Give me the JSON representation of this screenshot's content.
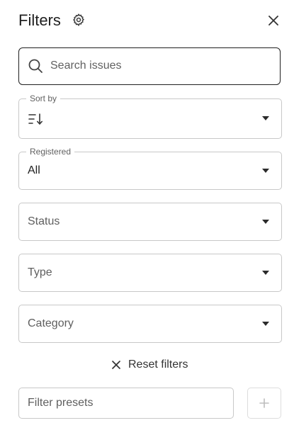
{
  "header": {
    "title": "Filters",
    "settings_icon": "gear-icon",
    "close_icon": "close-icon"
  },
  "search": {
    "placeholder": "Search issues",
    "value": "",
    "icon": "search-icon"
  },
  "filters": {
    "sort_by": {
      "label": "Sort by",
      "value": "",
      "icon": "sort-icon"
    },
    "registered": {
      "label": "Registered",
      "value": "All"
    },
    "status": {
      "placeholder": "Status"
    },
    "type": {
      "placeholder": "Type"
    },
    "category": {
      "placeholder": "Category"
    }
  },
  "reset": {
    "label": "Reset filters",
    "icon": "close-icon"
  },
  "presets": {
    "placeholder": "Filter presets",
    "value": "",
    "add_icon": "plus-icon"
  },
  "colors": {
    "text": "#212121",
    "muted": "#616161",
    "border": "#c8c8c8",
    "focus_border": "#1f1f1f"
  }
}
